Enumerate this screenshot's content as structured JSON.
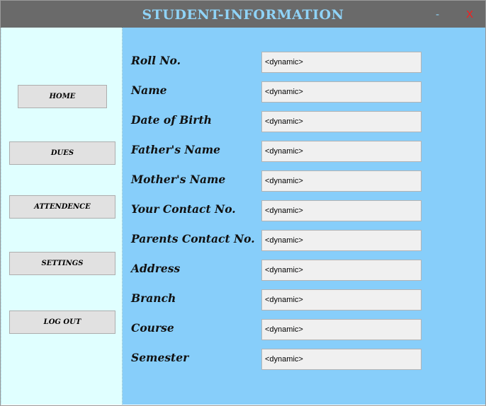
{
  "window": {
    "title": "STUDENT-INFORMATION",
    "minimize_label": "-",
    "close_label": "X"
  },
  "sidebar": {
    "items": [
      {
        "label": "HOME"
      },
      {
        "label": "DUES"
      },
      {
        "label": "ATTENDENCE"
      },
      {
        "label": "SETTINGS"
      },
      {
        "label": "LOG OUT"
      }
    ]
  },
  "form": {
    "fields": [
      {
        "label": "Roll No.",
        "value": "<dynamic>"
      },
      {
        "label": "Name",
        "value": "<dynamic>"
      },
      {
        "label": "Date of Birth",
        "value": "<dynamic>"
      },
      {
        "label": "Father's Name",
        "value": "<dynamic>"
      },
      {
        "label": "Mother's Name",
        "value": "<dynamic>"
      },
      {
        "label": "Your Contact No.",
        "value": "<dynamic>"
      },
      {
        "label": "Parents Contact No.",
        "value": "<dynamic>"
      },
      {
        "label": "Address",
        "value": "<dynamic>"
      },
      {
        "label": "Branch",
        "value": "<dynamic>"
      },
      {
        "label": "Course",
        "value": "<dynamic>"
      },
      {
        "label": "Semester",
        "value": "<dynamic>"
      }
    ]
  },
  "colors": {
    "titlebar": "#6a6a6a",
    "title_text": "#8fd3f7",
    "sidebar_bg": "#e0ffff",
    "main_bg": "#87cefa",
    "close_accent": "#ff1a1a"
  }
}
